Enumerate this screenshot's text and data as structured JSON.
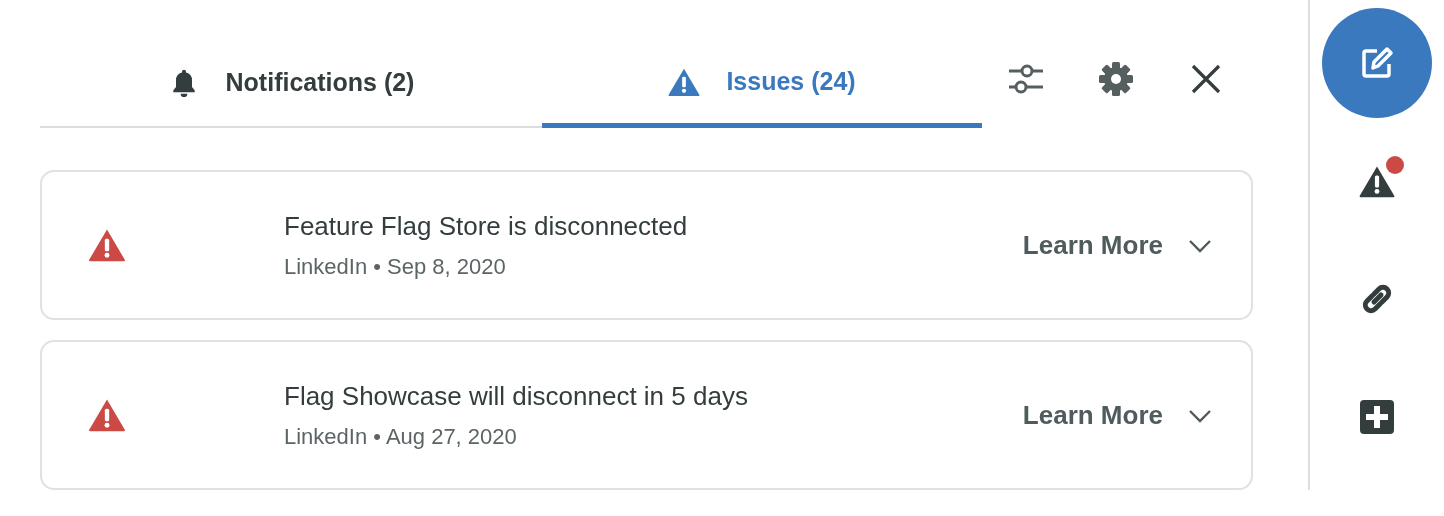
{
  "tabs": [
    {
      "label": "Notifications (2)",
      "selected": false
    },
    {
      "label": "Issues (24)",
      "selected": true
    }
  ],
  "issues": [
    {
      "title": "Feature Flag Store is disconnected",
      "source": "LinkedIn",
      "separator": "•",
      "date": "Sep 8, 2020",
      "action": "Learn More",
      "expanded": false
    },
    {
      "title": "Flag Showcase will disconnect in 5 days",
      "source": "LinkedIn",
      "separator": "•",
      "date": "Aug 27, 2020",
      "action": "Learn More",
      "expanded": false
    }
  ],
  "sidebar": [
    {
      "selected": true,
      "alert": false
    },
    {
      "selected": false,
      "alert": true
    },
    {
      "selected": false,
      "alert": false
    },
    {
      "selected": false,
      "alert": false
    }
  ]
}
